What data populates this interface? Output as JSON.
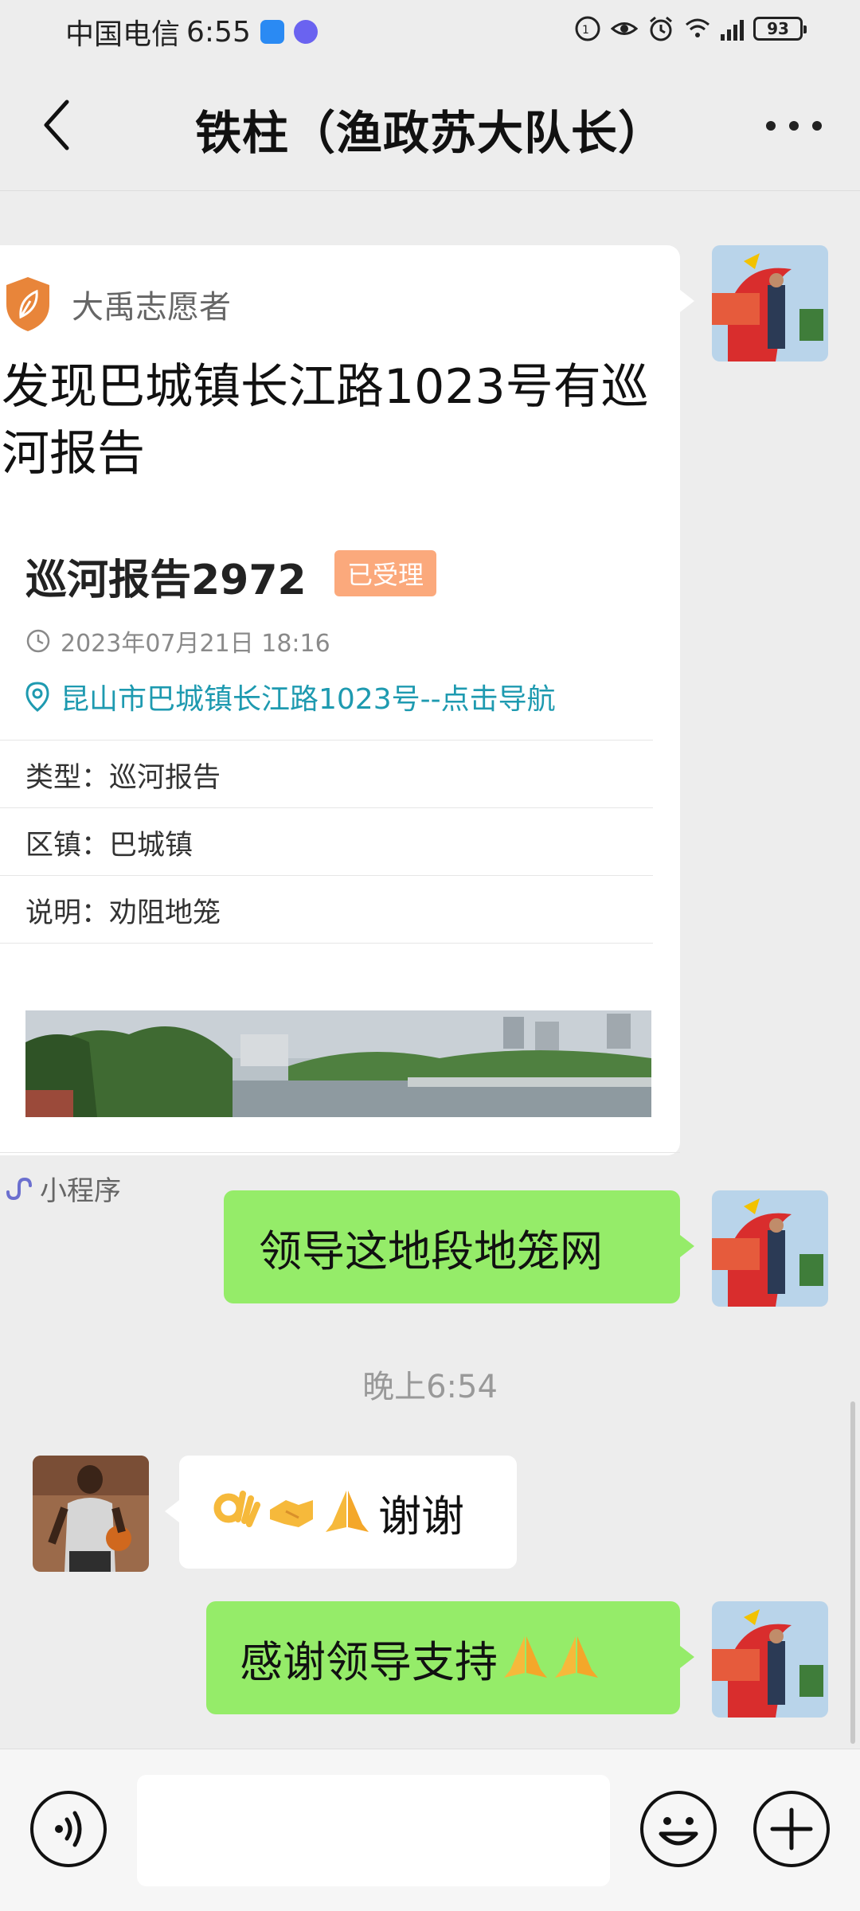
{
  "status_bar": {
    "carrier": "中国电信",
    "time": "6:55",
    "battery": "93"
  },
  "nav": {
    "title": "铁柱（渔政苏大队长）"
  },
  "card": {
    "source": "大禹志愿者",
    "headline": "发现巴城镇长江路1023号有巡河报告",
    "report_title": "巡河报告2972",
    "status_badge": "已受理",
    "datetime": "2023年07月21日 18:16",
    "location": "昆山市巴城镇长江路1023号--点击导航",
    "rows": [
      {
        "label": "类型：",
        "value": "巡河报告"
      },
      {
        "label": "区镇：",
        "value": "巴城镇"
      },
      {
        "label": "说明：",
        "value": "劝阻地笼"
      }
    ],
    "footer": "小程序"
  },
  "messages": {
    "sent_1": "领导这地段地笼网",
    "timestamp": "晚上6:54",
    "received_1_text": "谢谢",
    "sent_2_text": "感谢领导支持"
  },
  "colors": {
    "green_bubble": "#95ec69",
    "badge": "#fba97c",
    "link": "#1e9ab0",
    "leaf": "#e8853a"
  }
}
